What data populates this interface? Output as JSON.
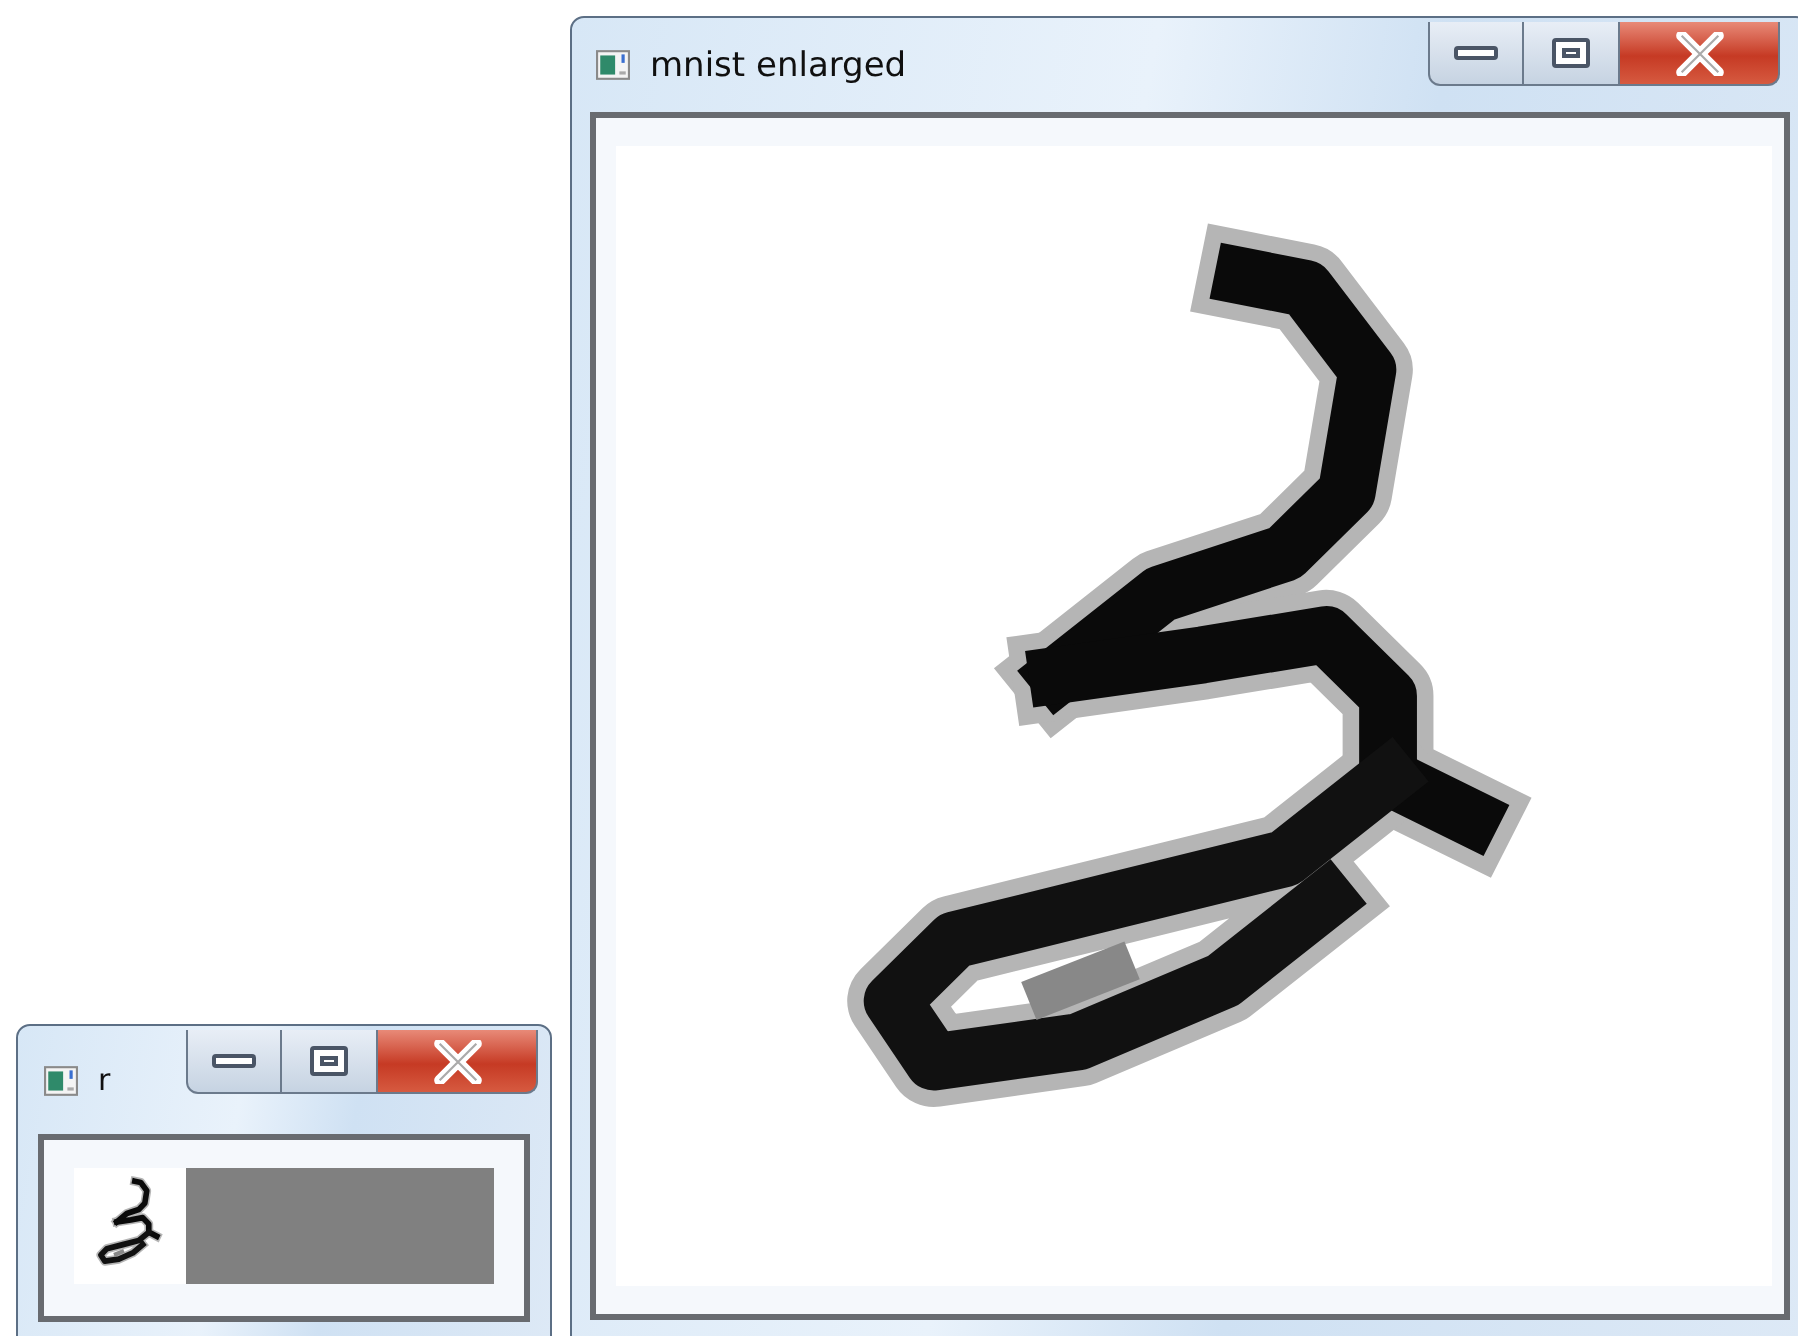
{
  "windows": [
    {
      "kind": "preview",
      "title": "r"
    },
    {
      "kind": "enlarged",
      "title": "mnist enlarged"
    }
  ]
}
